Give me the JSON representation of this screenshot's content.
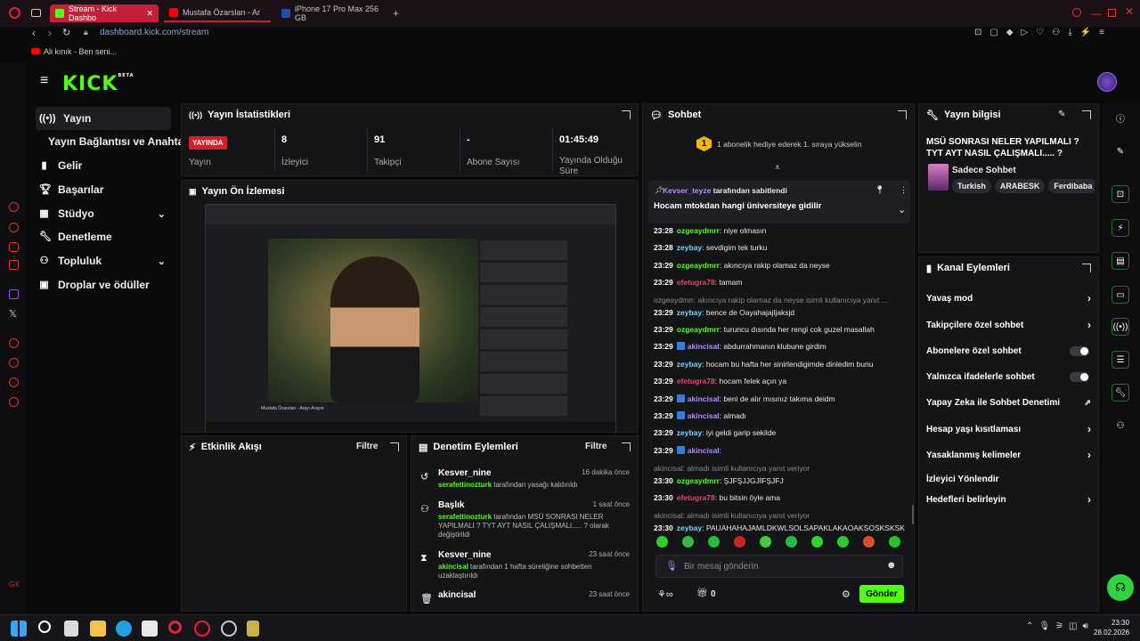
{
  "browser": {
    "tabs": [
      {
        "label": "Stream - Kick Dashbo",
        "active": true
      },
      {
        "label": "Mustafa Özarslan - Ar",
        "active": false
      },
      {
        "label": "iPhone 17 Pro Max 256 GB",
        "active": false
      }
    ],
    "url": "dashboard.kick.com/stream",
    "bookmark": "Ali kınık - Ben seni...",
    "clock_time": "23:30",
    "clock_date": "28.02.2026"
  },
  "kick": {
    "logo": "KICK",
    "logo_sup": "BETA"
  },
  "nav": {
    "items": [
      {
        "label": "Yayın",
        "selected": true
      },
      {
        "label": "Yayın Bağlantısı ve Anahtarı",
        "selected": false
      },
      {
        "label": "Gelir",
        "selected": false
      },
      {
        "label": "Başarılar",
        "selected": false
      },
      {
        "label": "Stüdyo",
        "selected": false
      },
      {
        "label": "Denetleme",
        "selected": false
      },
      {
        "label": "Topluluk",
        "selected": false
      },
      {
        "label": "Droplar ve ödüller",
        "selected": false
      }
    ]
  },
  "stats": {
    "title": "Yayın İstatistikleri",
    "live_badge": "YAYINDA",
    "live_label": "Yayın",
    "viewers_value": "8",
    "viewers_label": "İzleyici",
    "followers_value": "91",
    "followers_label": "Takipçi",
    "subs_value": "-",
    "subs_label": "Abone Sayısı",
    "uptime_value": "01:45:49",
    "uptime_label": "Yayında Olduğu Süre"
  },
  "preview": {
    "title": "Yayın Ön İzlemesi",
    "video_caption": "Mustafa Özarslan - Arayı Arayın"
  },
  "activity": {
    "title": "Etkinlik Akışı",
    "filter": "Filtre"
  },
  "modlog": {
    "title": "Denetim Eylemleri",
    "filter": "Filtre",
    "entries": [
      {
        "name": "Kesver_nine",
        "time": "16 dakika önce",
        "actor": "serafettinozturk",
        "text": "tarafından yasağı kaldırıldı"
      },
      {
        "name": "Başlık",
        "time": "1 saat önce",
        "actor": "serafettinozturk",
        "text": "tarafından MSÜ SONRASI NELER YAPILMALI ? TYT AYT NASIL ÇALIŞMALI..... ? olarak değiştirildi"
      },
      {
        "name": "Kesver_nine",
        "time": "23 saat önce",
        "actor": "akincisal",
        "text": "tarafından 1 hafta süreliğine sohbetten uzaklaştırıldı"
      },
      {
        "name": "akincisal",
        "time": "23 saat önce",
        "actor": "",
        "text": ""
      }
    ]
  },
  "chat": {
    "title": "Sohbet",
    "gift_count": "1",
    "gift_text": "1 abonelik hediye ederek 1. sıraya yükselin",
    "pinned_by": "Kevser_teyze",
    "pinned_label": "tarafından sabitlendi",
    "pinned_msg": "Hocam mtokdan hangi üniversiteye gidilir",
    "messages": [
      {
        "time": "23:28",
        "user": "ozgeaydmrr",
        "cls": "u-g",
        "text": "niye olmasın"
      },
      {
        "time": "23:28",
        "user": "zeybay",
        "cls": "u-c",
        "text": "sevdigim tek turku"
      },
      {
        "time": "23:29",
        "user": "ozgeaydmrr",
        "cls": "u-g",
        "text": "akıncıya rakip olamaz da neyse"
      },
      {
        "time": "23:29",
        "user": "efetugra78",
        "cls": "u-r",
        "text": "tamam"
      },
      {
        "reply": "ozgeaydmrr: akıncıya rakip olamaz da neyse isimli kullanıcıya yanıt ..."
      },
      {
        "time": "23:29",
        "user": "zeybay",
        "cls": "u-c",
        "text": "bence de Oayahajajljaksjd"
      },
      {
        "time": "23:29",
        "user": "ozgeaydmrr",
        "cls": "u-g",
        "text": "turuncu dısında her rengi cok guzel masallah"
      },
      {
        "time": "23:29",
        "user": "akincisal",
        "cls": "u-p",
        "badge": true,
        "text": "abdurrahmanın klubune girdim"
      },
      {
        "time": "23:29",
        "user": "zeybay",
        "cls": "u-c",
        "text": "hocam bu hafta her sinirlendigimde dinledim bunu"
      },
      {
        "time": "23:29",
        "user": "efetugra78",
        "cls": "u-r",
        "text": "hocam felek açın ya"
      },
      {
        "time": "23:29",
        "user": "akincisal",
        "cls": "u-p",
        "badge": true,
        "text": "beni de alır mısınız takıma deidm"
      },
      {
        "time": "23:29",
        "user": "akincisal",
        "cls": "u-p",
        "badge": true,
        "text": "almadı"
      },
      {
        "time": "23:29",
        "user": "zeybay",
        "cls": "u-c",
        "text": "iyi geldi garip sekilde"
      },
      {
        "time": "23:29",
        "user": "akincisal",
        "cls": "u-p",
        "badge": true,
        "text": ""
      },
      {
        "reply": "akincisal: almadı isimli kullanıcıya yanıt veriyor"
      },
      {
        "time": "23:30",
        "user": "ozgeaydmrr",
        "cls": "u-g",
        "text": "ŞJFŞJJGJİFŞJFJ"
      },
      {
        "time": "23:30",
        "user": "efetugra78",
        "cls": "u-r",
        "text": "bu bitsin öyle ama"
      },
      {
        "reply": "akincisal: almadı isimli kullanıcıya yanıt veriyor"
      },
      {
        "time": "23:30",
        "user": "zeybay",
        "cls": "u-c",
        "text": "PAUAHAHAJAMLDKWLSOLSAPAKLAKAOAKSOSKSKSK"
      }
    ],
    "input_placeholder": "Bir mesaj gönderin",
    "points": "0",
    "send": "Gönder"
  },
  "info": {
    "title": "Yayın bilgisi",
    "stream_title": "MSÜ SONRASI NELER YAPILMALI ? TYT AYT NASIL ÇALIŞMALI..... ?",
    "category": "Sadece Sohbet",
    "tags": [
      "Turkish",
      "ARABESK",
      "Ferdibaba"
    ]
  },
  "channel": {
    "title": "Kanal Eylemleri",
    "actions": [
      {
        "label": "Yavaş mod",
        "kind": "arrow"
      },
      {
        "label": "Takipçilere özel sohbet",
        "kind": "arrow"
      },
      {
        "label": "Abonelere özel sohbet",
        "kind": "toggle"
      },
      {
        "label": "Yalnızca ifadelerle sohbet",
        "kind": "toggle"
      },
      {
        "label": "Yapay Zeka ile Sohbet Denetimi",
        "kind": "link"
      },
      {
        "label": "Hesap yaşı kısıtlaması",
        "kind": "arrow"
      },
      {
        "label": "Yasaklanmış kelimeler",
        "kind": "arrow"
      },
      {
        "label": "İzleyici Yönlendir",
        "kind": "none"
      },
      {
        "label": "Hedefleri belirleyin",
        "kind": "arrow"
      }
    ]
  },
  "colors": {
    "accent": "#53fc18",
    "live": "#d41f2b",
    "tab": "#c41f3a"
  }
}
